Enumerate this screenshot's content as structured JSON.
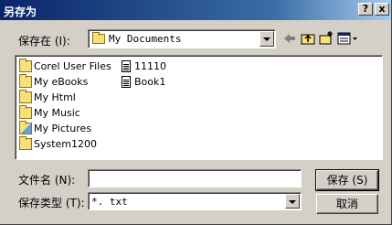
{
  "window": {
    "title": "另存为"
  },
  "titlebar_buttons": {
    "help": "?",
    "close": "x"
  },
  "save_in": {
    "label": "保存在 (I):",
    "value": "My Documents"
  },
  "files": [
    {
      "name": "Corel User Files",
      "icon": "folder-icon"
    },
    {
      "name": "My eBooks",
      "icon": "folder-icon"
    },
    {
      "name": "My Html",
      "icon": "folder-icon"
    },
    {
      "name": "My Music",
      "icon": "folder-icon"
    },
    {
      "name": "My Pictures",
      "icon": "folder-pictures-icon"
    },
    {
      "name": "System1200",
      "icon": "folder-icon"
    },
    {
      "name": "11110",
      "icon": "text-document-icon"
    },
    {
      "name": "Book1",
      "icon": "text-document-icon"
    }
  ],
  "filename": {
    "label": "文件名 (N):",
    "value": ""
  },
  "filetype": {
    "label": "保存类型 (T):",
    "value": "*. txt"
  },
  "buttons": {
    "save": "保存 (S)",
    "cancel": "取消"
  }
}
